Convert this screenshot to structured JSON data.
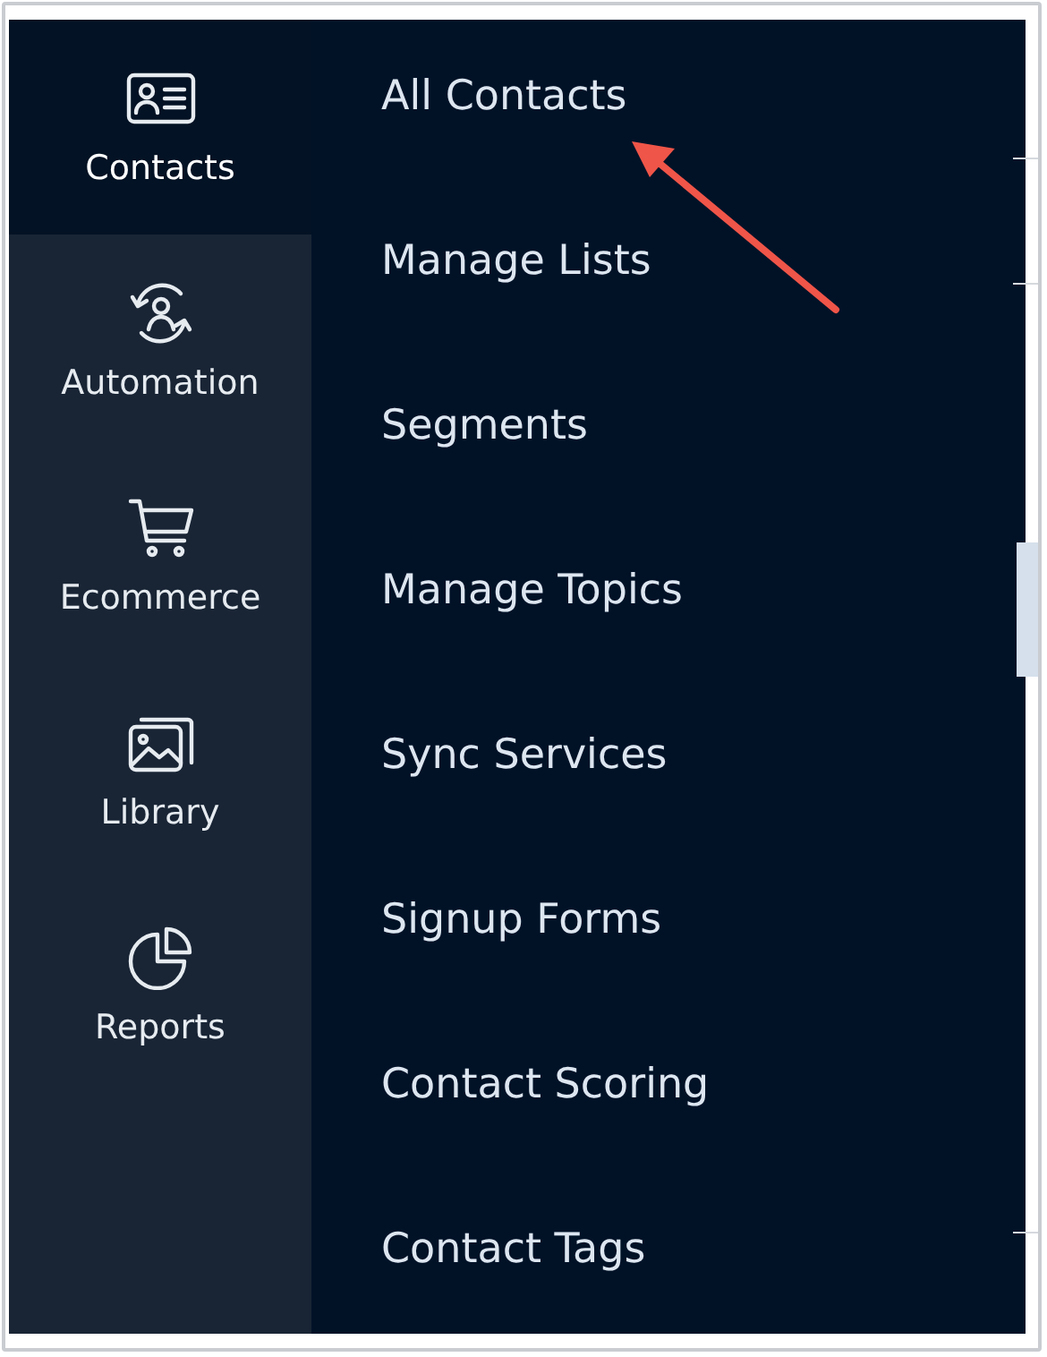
{
  "sidebar": {
    "items": [
      {
        "label": "Contacts",
        "selected": true
      },
      {
        "label": "Automation",
        "selected": false
      },
      {
        "label": "Ecommerce",
        "selected": false
      },
      {
        "label": "Library",
        "selected": false
      },
      {
        "label": "Reports",
        "selected": false
      }
    ]
  },
  "submenu": {
    "items": [
      {
        "label": "All Contacts"
      },
      {
        "label": "Manage Lists"
      },
      {
        "label": "Segments"
      },
      {
        "label": "Manage Topics"
      },
      {
        "label": "Sync Services"
      },
      {
        "label": "Signup Forms"
      },
      {
        "label": "Contact Scoring"
      },
      {
        "label": "Contact Tags"
      }
    ]
  }
}
